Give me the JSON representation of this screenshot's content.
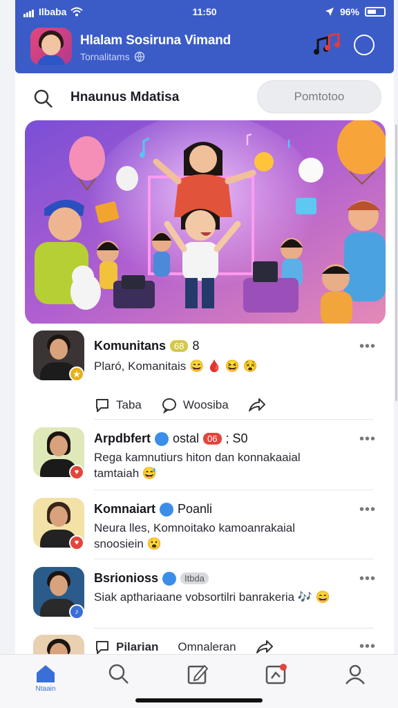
{
  "status": {
    "carrier": "Ilbaba",
    "time": "11:50",
    "battery": "96%"
  },
  "header": {
    "title": "Hlalam Sosiruna Vimand",
    "subtitle": "Tornalitams"
  },
  "search": {
    "query": "Hnaunus Mdatisa",
    "button_label": "Pomtotoo"
  },
  "feed": {
    "posts": [
      {
        "name": "Komunitans",
        "chip": "68",
        "chip_suffix": "8",
        "text": "Plaró, Komanitais 😄 🩸 😆 😵",
        "actions": {
          "comment": "Taba",
          "like": "Woosiba"
        }
      },
      {
        "name": "Arpdbfert",
        "tag": "ostal",
        "chip": "06",
        "chip_suffix": "; S0",
        "text": "Rega kamnutiurs hiton dan konnakaaial tamtaiah 😅"
      },
      {
        "name": "Komnaiart",
        "tag": "Poanli",
        "text": "Neura lles, Komnoitako kamoanrakaial snoosiein 😮"
      },
      {
        "name": "Bsrionioss",
        "tag": "Itbda",
        "text": "Siak apthariaane vobsortilri banrakeria 🎶 😄"
      },
      {
        "actions": {
          "comment": "Pilarian",
          "like": "Omnaleran"
        }
      }
    ]
  },
  "tabbar": {
    "home_label": "Ntaain"
  },
  "colors": {
    "brand": "#3b5cc7",
    "accent": "#3b6fd8",
    "badge_yellow": "#e6b21c",
    "badge_red": "#e2453c",
    "badge_blue": "#3b6fd8"
  }
}
